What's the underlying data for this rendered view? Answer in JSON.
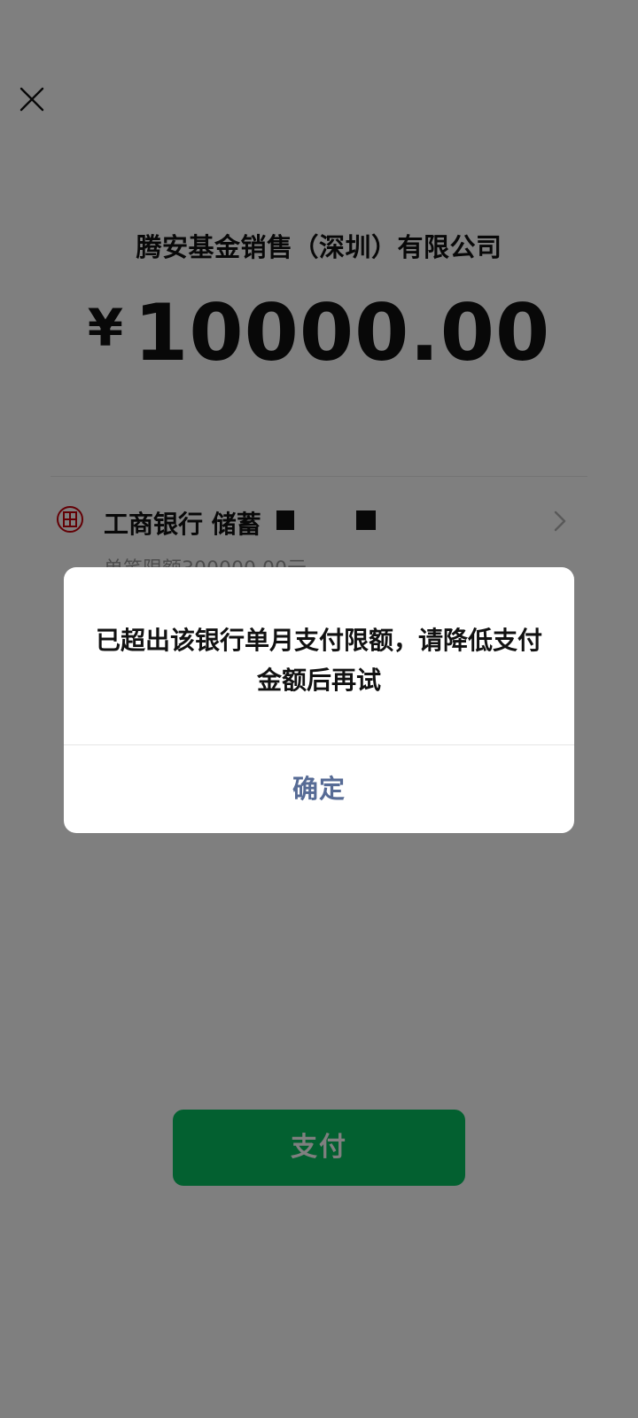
{
  "header": {
    "close_icon": "close-icon"
  },
  "payment": {
    "merchant": "腾安基金销售（深圳）有限公司",
    "currency_symbol": "¥",
    "amount": "10000.00"
  },
  "bank": {
    "icon": "icbc-logo-icon",
    "name": "工商银行 储蓄",
    "limit": "单笔限额300000.00元"
  },
  "pay_button": {
    "label": "支付"
  },
  "dialog": {
    "message": "已超出该银行单月支付限额，请降低支付金额后再试",
    "confirm_label": "确定"
  },
  "colors": {
    "brand_green": "#07c160",
    "dialog_link": "#576b95",
    "icbc_red": "#c7000b"
  }
}
